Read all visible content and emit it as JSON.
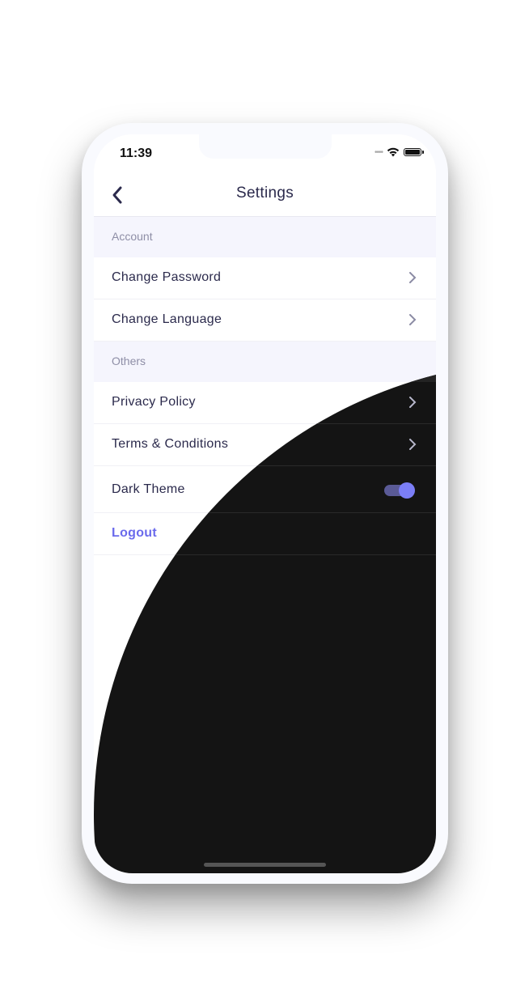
{
  "status_bar": {
    "time": "11:39",
    "signal": "signal-dots-icon",
    "wifi": "wifi-icon",
    "battery": "battery-icon"
  },
  "header": {
    "title": "Settings",
    "back_icon": "chevron-left-icon"
  },
  "sections": [
    {
      "title": "Account",
      "items": [
        {
          "label": "Change Password",
          "type": "link"
        },
        {
          "label": "Change Language",
          "type": "link"
        }
      ]
    },
    {
      "title": "Others",
      "items": [
        {
          "label": "Privacy Policy",
          "type": "link"
        },
        {
          "label": "Terms & Conditions",
          "type": "link"
        },
        {
          "label": "Dark Theme",
          "type": "toggle",
          "value": true
        },
        {
          "label": "Logout",
          "type": "action"
        }
      ]
    }
  ],
  "colors": {
    "accent": "#6b6bec",
    "toggle_knob": "#7b7ef6",
    "toggle_track": "#5a5a96",
    "text": "#2b2a4c",
    "section_bg": "#f5f5fd",
    "dark_bg": "#141414"
  }
}
